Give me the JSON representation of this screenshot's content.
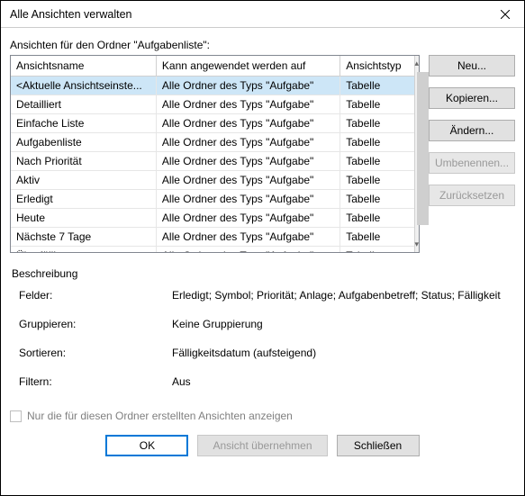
{
  "window": {
    "title": "Alle Ansichten verwalten"
  },
  "subtitle": "Ansichten für den Ordner \"Aufgabenliste\":",
  "columns": {
    "name": "Ansichtsname",
    "scope": "Kann angewendet werden auf",
    "type": "Ansichtstyp"
  },
  "rows": [
    {
      "name": "<Aktuelle Ansichtseinste...",
      "scope": "Alle Ordner des Typs \"Aufgabe\"",
      "type": "Tabelle",
      "selected": true
    },
    {
      "name": "Detailliert",
      "scope": "Alle Ordner des Typs \"Aufgabe\"",
      "type": "Tabelle"
    },
    {
      "name": "Einfache Liste",
      "scope": "Alle Ordner des Typs \"Aufgabe\"",
      "type": "Tabelle"
    },
    {
      "name": "Aufgabenliste",
      "scope": "Alle Ordner des Typs \"Aufgabe\"",
      "type": "Tabelle"
    },
    {
      "name": "Nach Priorität",
      "scope": "Alle Ordner des Typs \"Aufgabe\"",
      "type": "Tabelle"
    },
    {
      "name": "Aktiv",
      "scope": "Alle Ordner des Typs \"Aufgabe\"",
      "type": "Tabelle"
    },
    {
      "name": "Erledigt",
      "scope": "Alle Ordner des Typs \"Aufgabe\"",
      "type": "Tabelle"
    },
    {
      "name": "Heute",
      "scope": "Alle Ordner des Typs \"Aufgabe\"",
      "type": "Tabelle"
    },
    {
      "name": "Nächste 7 Tage",
      "scope": "Alle Ordner des Typs \"Aufgabe\"",
      "type": "Tabelle"
    },
    {
      "name": "Überfällig",
      "scope": "Alle Ordner des Typs \"Aufgabe\"",
      "type": "Tabelle"
    }
  ],
  "sidebuttons": {
    "new": "Neu...",
    "copy": "Kopieren...",
    "modify": "Ändern...",
    "rename": "Umbenennen...",
    "reset": "Zurücksetzen"
  },
  "description": {
    "title": "Beschreibung",
    "fields_k": "Felder:",
    "fields_v": "Erledigt; Symbol; Priorität; Anlage; Aufgabenbetreff; Status; Fälligkeit",
    "group_k": "Gruppieren:",
    "group_v": "Keine Gruppierung",
    "sort_k": "Sortieren:",
    "sort_v": "Fälligkeitsdatum (aufsteigend)",
    "filter_k": "Filtern:",
    "filter_v": "Aus"
  },
  "checkbox_label": "Nur die für diesen Ordner erstellten Ansichten anzeigen",
  "bottom": {
    "ok": "OK",
    "apply": "Ansicht übernehmen",
    "close": "Schließen"
  }
}
